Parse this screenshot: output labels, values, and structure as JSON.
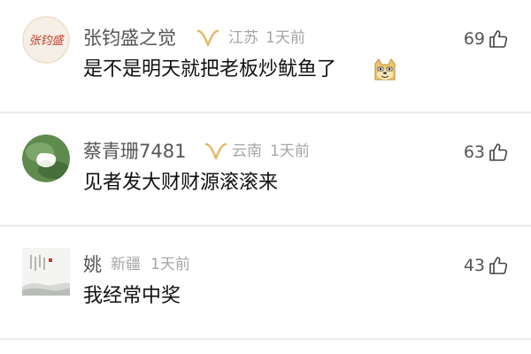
{
  "comments": [
    {
      "username": "张钧盛之觉",
      "location": "江苏",
      "time": "1天前",
      "content": "是不是明天就把老板炒鱿鱼了",
      "likes": "69",
      "avatar_text": "张钧盛",
      "has_badge": true,
      "has_emoji": true,
      "emoji_icon": "doge-emoji-icon"
    },
    {
      "username": "蔡青珊7481",
      "location": "云南",
      "time": "1天前",
      "content": "见者发大财财源滚滚来",
      "likes": "63",
      "has_badge": true
    },
    {
      "username": "姚",
      "location": "新疆",
      "time": "1天前",
      "content": "我经常中奖",
      "likes": "43",
      "has_badge": false
    }
  ],
  "colors": {
    "badge": "#e3b765",
    "username": "#555555",
    "meta": "#a6a6a6",
    "content": "#111111",
    "avatar1_text": "#c23d2f"
  },
  "icons": {
    "badge": "vip-badge-icon",
    "like": "thumbs-up-icon"
  }
}
